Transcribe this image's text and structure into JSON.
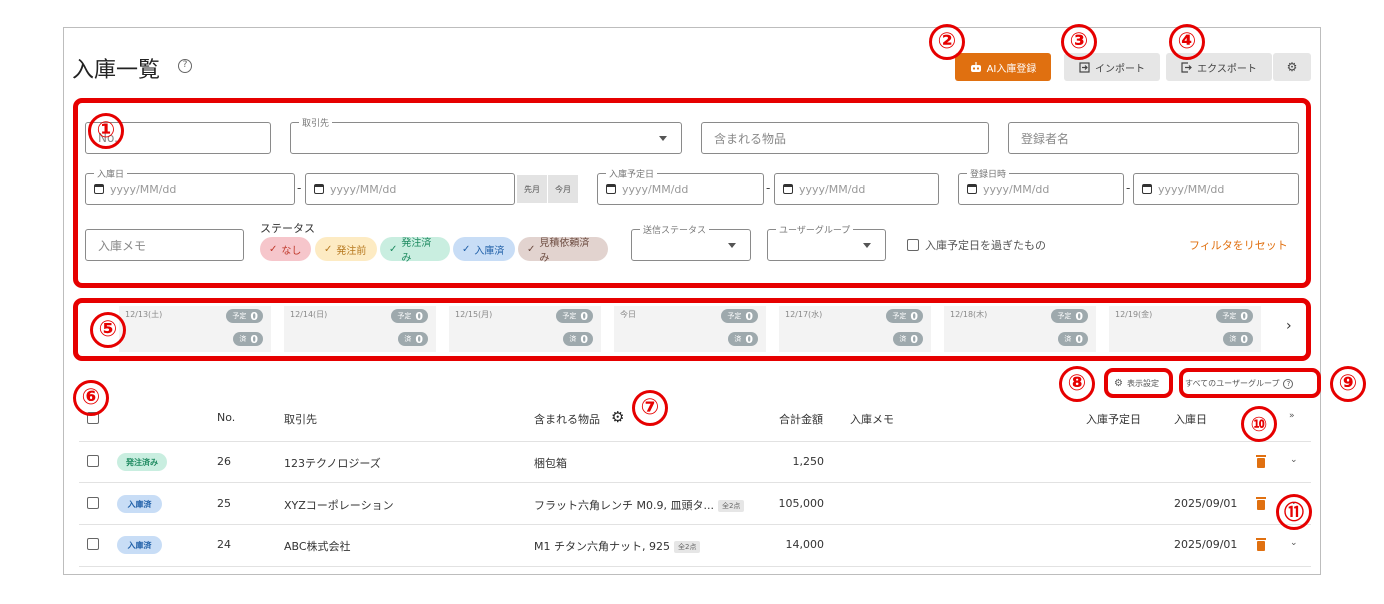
{
  "header": {
    "title": "入庫一覧",
    "help_icon": "?",
    "ai_button": "AI入庫登録",
    "import_button": "インポート",
    "export_button": "エクスポート"
  },
  "annotations": [
    "①",
    "②",
    "③",
    "④",
    "⑤",
    "⑥",
    "⑦",
    "⑧",
    "⑨",
    "⑩",
    "⑪"
  ],
  "filters": {
    "no_placeholder": "No.",
    "supplier_label": "取引先",
    "items_placeholder": "含まれる物品",
    "registrant_placeholder": "登録者名",
    "receipt_date_label": "入庫日",
    "planned_date_label": "入庫予定日",
    "registered_at_label": "登録日時",
    "date_placeholder": "yyyy/MM/dd",
    "dash": "-",
    "last_month": "先月",
    "this_month": "今月",
    "memo_placeholder": "入庫メモ",
    "status_label": "ステータス",
    "status_chips": [
      {
        "label": "なし",
        "bg": "#f6c6cb",
        "fg": "#c0392b"
      },
      {
        "label": "発注前",
        "bg": "#fdebc3",
        "fg": "#b7791f"
      },
      {
        "label": "発注済み",
        "bg": "#c9eee0",
        "fg": "#1e8a60"
      },
      {
        "label": "入庫済",
        "bg": "#c8ddf6",
        "fg": "#1f5fa8"
      },
      {
        "label": "見積依頼済み",
        "bg": "#e2d3cf",
        "fg": "#6d4c41"
      }
    ],
    "send_status_label": "送信ステータス",
    "user_group_label": "ユーザーグループ",
    "overdue_label": "入庫予定日を過ぎたもの",
    "reset_link": "フィルタをリセット"
  },
  "calendar": {
    "plan_label": "予定",
    "done_label": "済",
    "days": [
      {
        "date": "12/13(土)",
        "plan": "0",
        "done": "0"
      },
      {
        "date": "12/14(日)",
        "plan": "0",
        "done": "0"
      },
      {
        "date": "12/15(月)",
        "plan": "0",
        "done": "0"
      },
      {
        "date": "今日",
        "plan": "0",
        "done": "0"
      },
      {
        "date": "12/17(水)",
        "plan": "0",
        "done": "0"
      },
      {
        "date": "12/18(木)",
        "plan": "0",
        "done": "0"
      },
      {
        "date": "12/19(金)",
        "plan": "0",
        "done": "0"
      }
    ],
    "next_icon": "›"
  },
  "table": {
    "display_settings": "表示設定",
    "all_user_groups": "すべてのユーザーグループ",
    "headers": {
      "no": "No.",
      "supplier": "取引先",
      "items": "含まれる物品",
      "total": "合計金額",
      "memo": "入庫メモ",
      "planned_date": "入庫予定日",
      "receipt_date": "入庫日"
    },
    "rows": [
      {
        "status": "発注済み",
        "status_bg": "#c9eee0",
        "status_fg": "#1e8a60",
        "no": "26",
        "supplier": "123テクノロジーズ",
        "items": "梱包箱",
        "count": "",
        "total": "1,250",
        "memo": "",
        "planned": "",
        "received": ""
      },
      {
        "status": "入庫済",
        "status_bg": "#c8ddf6",
        "status_fg": "#1f5fa8",
        "no": "25",
        "supplier": "XYZコーポレーション",
        "items": "フラット六角レンチ M0.9, 皿頭タ...",
        "count": "全2点",
        "total": "105,000",
        "memo": "",
        "planned": "",
        "received": "2025/09/01"
      },
      {
        "status": "入庫済",
        "status_bg": "#c8ddf6",
        "status_fg": "#1f5fa8",
        "no": "24",
        "supplier": "ABC株式会社",
        "items": "M1 チタン六角ナット, 925",
        "count": "全2点",
        "total": "14,000",
        "memo": "",
        "planned": "",
        "received": "2025/09/01"
      }
    ]
  },
  "colors": {
    "accent": "#e07010",
    "annotation_red": "#e60000"
  }
}
